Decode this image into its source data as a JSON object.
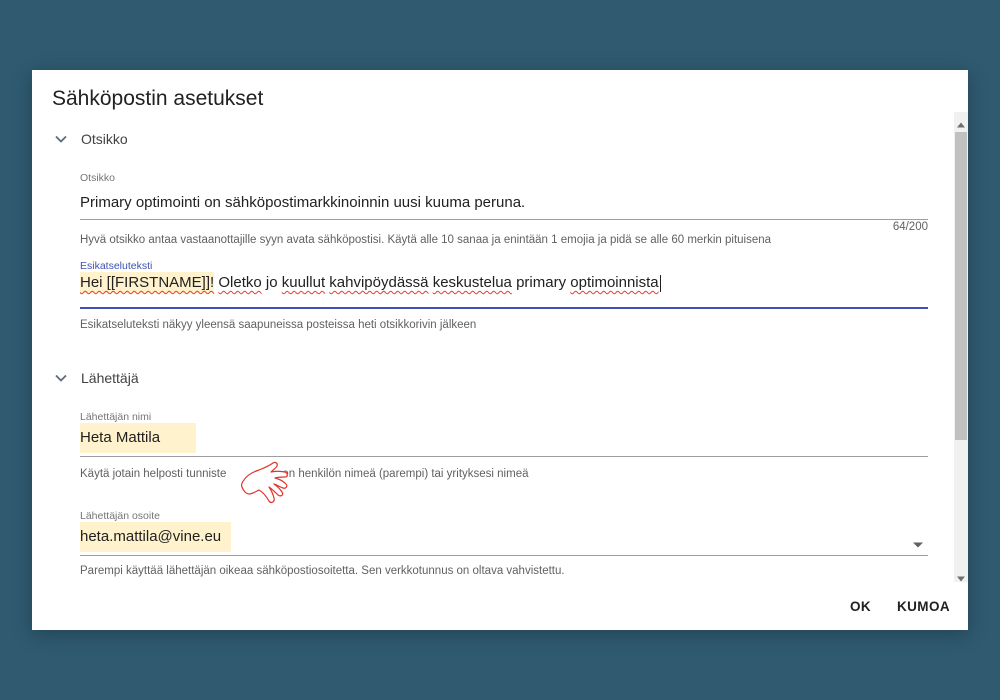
{
  "dialog": {
    "title": "Sähköpostin asetukset",
    "actions": {
      "ok_label": "OK",
      "cancel_label": "KUMOA"
    }
  },
  "sections": {
    "subject": {
      "header": "Otsikko",
      "subject_field": {
        "label": "Otsikko",
        "value": "Primary optimointi on sähköpostimarkkinoinnin uusi kuuma peruna.",
        "counter": "64/200",
        "hint": "Hyvä otsikko antaa vastaanottajille syyn avata sähköpostisi. Käytä alle 10 sanaa ja enintään 1 emojia ja pidä se alle 60 merkin pituisena"
      },
      "preview_field": {
        "label": "Esikatseluteksti",
        "value_token": "Hei [[FIRSTNAME]]!",
        "value_words": [
          "Oletko",
          "jo",
          "kuullut",
          "kahvipöydässä",
          "keskustelua",
          "primary",
          "optimoinnista"
        ],
        "hint": "Esikatseluteksti näkyy yleensä saapuneissa posteissa heti otsikkorivin jälkeen"
      }
    },
    "sender": {
      "header": "Lähettäjä",
      "name_field": {
        "label": "Lähettäjän nimi",
        "value": "Heta Mattila",
        "hint_before": "Käytä jotain helposti tunniste",
        "hint_after": "en henkilön nimeä (parempi) tai yrityksesi nimeä"
      },
      "address_field": {
        "label": "Lähettäjän osoite",
        "value": "heta.mattila@vine.eu",
        "hint": "Parempi käyttää lähettäjän oikeaa sähköpostiosoitetta. Sen verkkotunnus on oltava vahvistettu."
      }
    }
  },
  "colors": {
    "background": "#2f5a70",
    "accent": "#3f51b5",
    "highlight": "#fff2cc",
    "spellcheck": "#e53935"
  },
  "icons": [
    "chevron-down-icon",
    "dropdown-arrow-icon",
    "scroll-up-icon",
    "scroll-down-icon",
    "hand-pointer-icon"
  ]
}
